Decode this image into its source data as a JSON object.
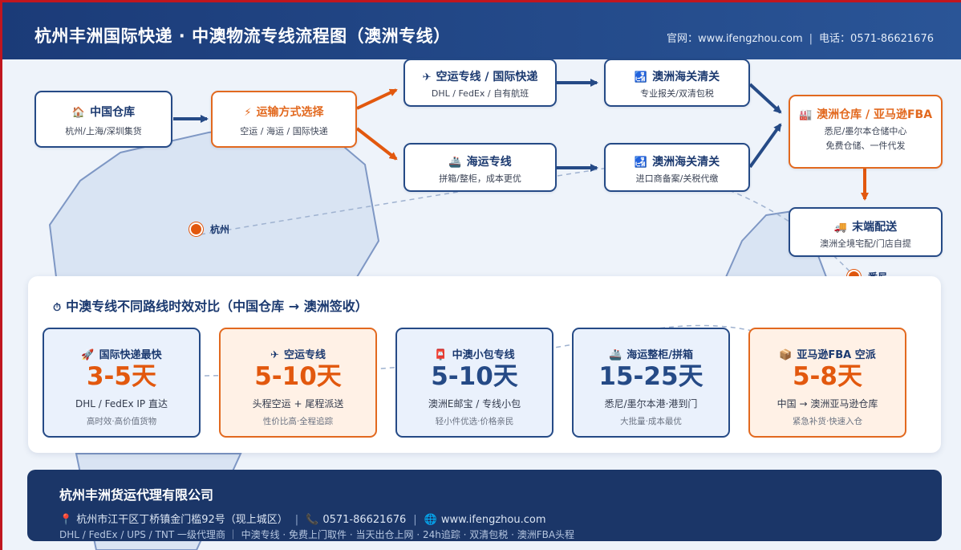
{
  "header": {
    "title": "杭州丰洲国际快递 · 中澳物流专线流程图（澳洲专线）",
    "website_label": "官网：www.ifengzhou.com",
    "phone_label": "电话：0571-86621676"
  },
  "flow": {
    "cn_warehouse": {
      "icon": "house-icon",
      "title": "中国仓库",
      "sub": "杭州/上海/深圳集货"
    },
    "transport_choice": {
      "icon": "lightning-icon",
      "title": "运输方式选择",
      "sub": "空运 / 海运 / 国际快递"
    },
    "air_express": {
      "icon": "airplane-icon",
      "title": "空运专线 / 国际快递",
      "sub": "DHL / FedEx / 自有航班"
    },
    "sea_line": {
      "icon": "ship-icon",
      "title": "海运专线",
      "sub": "拼箱/整柜，成本更优"
    },
    "customs_air": {
      "icon": "customs-icon",
      "title": "澳洲海关清关",
      "sub": "专业报关/双清包税"
    },
    "customs_sea": {
      "icon": "customs-icon",
      "title": "澳洲海关清关",
      "sub": "进口商备案/关税代缴"
    },
    "au_warehouse": {
      "icon": "factory-icon",
      "title": "澳洲仓库 / 亚马逊FBA",
      "sub1": "悉尼/墨尔本仓储中心",
      "sub2": "免费仓储、一件代发"
    },
    "last_mile": {
      "icon": "truck-icon",
      "title": "末端配送",
      "sub": "澳洲全境宅配/门店自提"
    }
  },
  "map": {
    "city_hangzhou": "杭州",
    "city_partial": "悉尼"
  },
  "comparison": {
    "icon": "stopwatch-icon",
    "title": "中澳专线不同路线时效对比（中国仓库 → 澳洲签收）",
    "cards": [
      {
        "icon": "rocket-icon",
        "title": "国际快递最快",
        "value": "3-5天",
        "desc": "DHL / FedEx IP 直达",
        "note": "高时效·高价值货物"
      },
      {
        "icon": "airplane-icon",
        "title": "空运专线",
        "value": "5-10天",
        "desc": "头程空运 + 尾程派送",
        "note": "性价比高·全程追踪"
      },
      {
        "icon": "parcel-icon",
        "title": "中澳小包专线",
        "value": "5-10天",
        "desc": "澳洲E邮宝 / 专线小包",
        "note": "轻小件优选·价格亲民"
      },
      {
        "icon": "ship-icon",
        "title": "海运整柜/拼箱",
        "value": "15-25天",
        "desc": "悉尼/墨尔本港·港到门",
        "note": "大批量·成本最优"
      },
      {
        "icon": "box-icon",
        "title": "亚马逊FBA 空派",
        "value": "5-8天",
        "desc": "中国 → 澳洲亚马逊仓库",
        "note": "紧急补货·快速入仓"
      }
    ]
  },
  "footer": {
    "company": "杭州丰洲货运代理有限公司",
    "address": "杭州市江干区丁桥镇金门槛92号（现上城区）",
    "phone": "0571-86621676",
    "website": "www.ifengzhou.com",
    "slogan": "DHL / FedEx / UPS / TNT 一级代理商 ｜ 中澳专线 · 免费上门取件 · 当天出仓上网 · 24h追踪 · 双清包税 · 澳洲FBA头程"
  },
  "colors": {
    "navy": "#1b3b78",
    "accent_orange": "#e2580e",
    "card_blue_bg": "#eaf1fc",
    "card_orange_bg": "#fff1e6"
  }
}
